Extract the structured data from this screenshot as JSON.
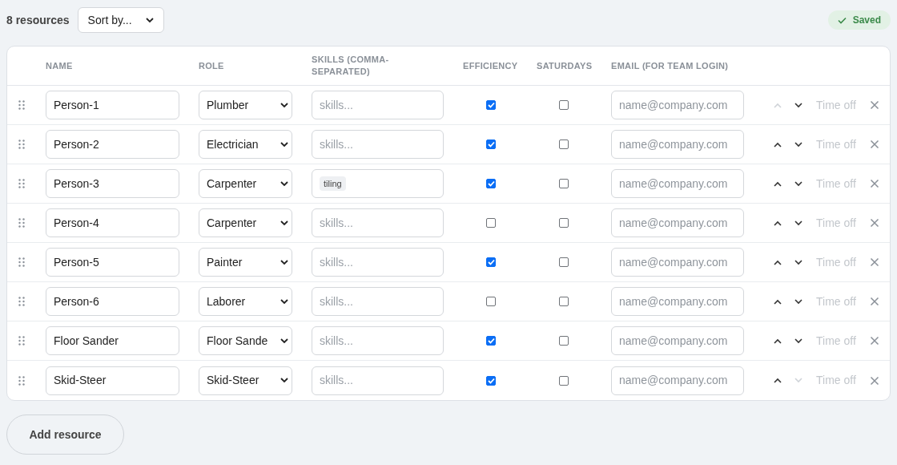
{
  "resource_count": "8 resources",
  "sort": {
    "value": "Sort by..."
  },
  "status": {
    "label": "Saved"
  },
  "columns": [
    "NAME",
    "ROLE",
    "SKILLS (COMMA-SEPARATED)",
    "EFFICIENCY",
    "SATURDAYS",
    "EMAIL (FOR TEAM LOGIN)"
  ],
  "rows": [
    {
      "name": "Person-1",
      "role": "Plumber",
      "skills_placeholder": "skills...",
      "efficiency": true,
      "saturdays": false,
      "email_placeholder": "name@company.com",
      "up_disabled": true,
      "down_disabled": false,
      "time_off": "Time off"
    },
    {
      "name": "Person-2",
      "role": "Electrician",
      "skills_placeholder": "skills...",
      "efficiency": true,
      "saturdays": false,
      "email_placeholder": "name@company.com",
      "up_disabled": false,
      "down_disabled": false,
      "time_off": "Time off"
    },
    {
      "name": "Person-3",
      "role": "Carpenter",
      "skills": [
        "tiling"
      ],
      "efficiency": true,
      "saturdays": false,
      "email_placeholder": "name@company.com",
      "up_disabled": false,
      "down_disabled": false,
      "time_off": "Time off"
    },
    {
      "name": "Person-4",
      "role": "Carpenter",
      "skills_placeholder": "skills...",
      "efficiency": false,
      "saturdays": false,
      "email_placeholder": "name@company.com",
      "up_disabled": false,
      "down_disabled": false,
      "time_off": "Time off"
    },
    {
      "name": "Person-5",
      "role": "Painter",
      "skills_placeholder": "skills...",
      "efficiency": true,
      "saturdays": false,
      "email_placeholder": "name@company.com",
      "up_disabled": false,
      "down_disabled": false,
      "time_off": "Time off"
    },
    {
      "name": "Person-6",
      "role": "Laborer",
      "skills_placeholder": "skills...",
      "efficiency": false,
      "saturdays": false,
      "email_placeholder": "name@company.com",
      "up_disabled": false,
      "down_disabled": false,
      "time_off": "Time off"
    },
    {
      "name": "Floor Sander",
      "role": "Floor Sande",
      "skills_placeholder": "skills...",
      "efficiency": true,
      "saturdays": false,
      "email_placeholder": "name@company.com",
      "up_disabled": false,
      "down_disabled": false,
      "time_off": "Time off"
    },
    {
      "name": "Skid-Steer",
      "role": "Skid-Steer",
      "skills_placeholder": "skills...",
      "efficiency": true,
      "saturdays": false,
      "email_placeholder": "name@company.com",
      "up_disabled": false,
      "down_disabled": true,
      "time_off": "Time off"
    }
  ],
  "add_button": "Add resource"
}
